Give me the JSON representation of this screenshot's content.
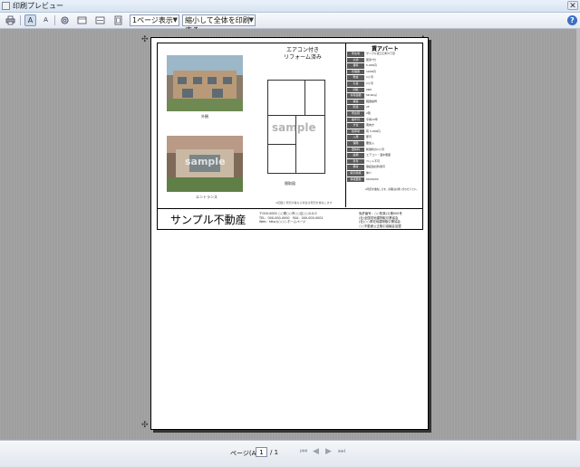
{
  "window": {
    "title": "印刷プレビュー",
    "close_glyph": "✕"
  },
  "toolbar": {
    "print_icon": "printer-icon",
    "page_display_select": "1ページ表示",
    "scale_select": "縮小して全体を印刷する",
    "font_a_label": "A",
    "font_a2_label": "A",
    "help_label": "?"
  },
  "flyer": {
    "photo1_caption": "外観",
    "photo2_caption": "エントランス",
    "sample_text": "sample",
    "plan_title_line1": "エアコン付き",
    "plan_title_line2": "リフォーム済み",
    "plan_caption": "間取図",
    "plan_copyright": "※図面と現況が異なる場合は現況を優先します",
    "property_name": "賃アパート",
    "specs": [
      {
        "label": "所在地",
        "value": "サンプル区〇〇町3丁目"
      },
      {
        "label": "交通",
        "value": "徒歩7分"
      },
      {
        "label": "賃料",
        "value": "5,000円"
      },
      {
        "label": "管理費",
        "value": "1000円"
      },
      {
        "label": "敷金",
        "value": "1ヶ月"
      },
      {
        "label": "礼金",
        "value": "1ヶ月"
      },
      {
        "label": "間取",
        "value": "2DK"
      },
      {
        "label": "専有面積",
        "value": "56.60㎡"
      },
      {
        "label": "構造",
        "value": "軽量鉄骨"
      },
      {
        "label": "階建",
        "value": "2F"
      },
      {
        "label": "所在階",
        "value": "2階"
      },
      {
        "label": "築年月",
        "value": "平成10年"
      },
      {
        "label": "方位",
        "value": "南向き"
      },
      {
        "label": "駐車場",
        "value": "有 5,000円"
      },
      {
        "label": "入居",
        "value": "即可"
      },
      {
        "label": "保険",
        "value": "要加入"
      },
      {
        "label": "更新料",
        "value": "新賃料の1ヶ月"
      },
      {
        "label": "設備",
        "value": "エアコン・温水便座"
      },
      {
        "label": "条件",
        "value": "ペット不可"
      },
      {
        "label": "備考",
        "value": "保証会社利用可"
      },
      {
        "label": "取引態様",
        "value": "仲介"
      },
      {
        "label": "情報更新",
        "value": "00/00/00"
      }
    ],
    "spec_note": "※現況を優先します。詳細はお問い合わせ下さい。",
    "company_name": "サンプル不動産",
    "contact_lines": [
      "〒000-0000 ○○県○○市○○区○○0-0-0",
      "TEL：000-000-0000　FAX：000-000-0001",
      "Web：http://○○○.ホームページ"
    ],
    "license_lines": [
      "免許番号：○○知事(1)第000号",
      "(社)全国宅地建物取引業協会",
      "(社)○○県宅地建物取引業協会",
      "○○不動産公正取引協議会加盟"
    ]
  },
  "statusbar": {
    "page_label": "ページ(A)",
    "page_value": "1",
    "page_total": "/ 1"
  }
}
